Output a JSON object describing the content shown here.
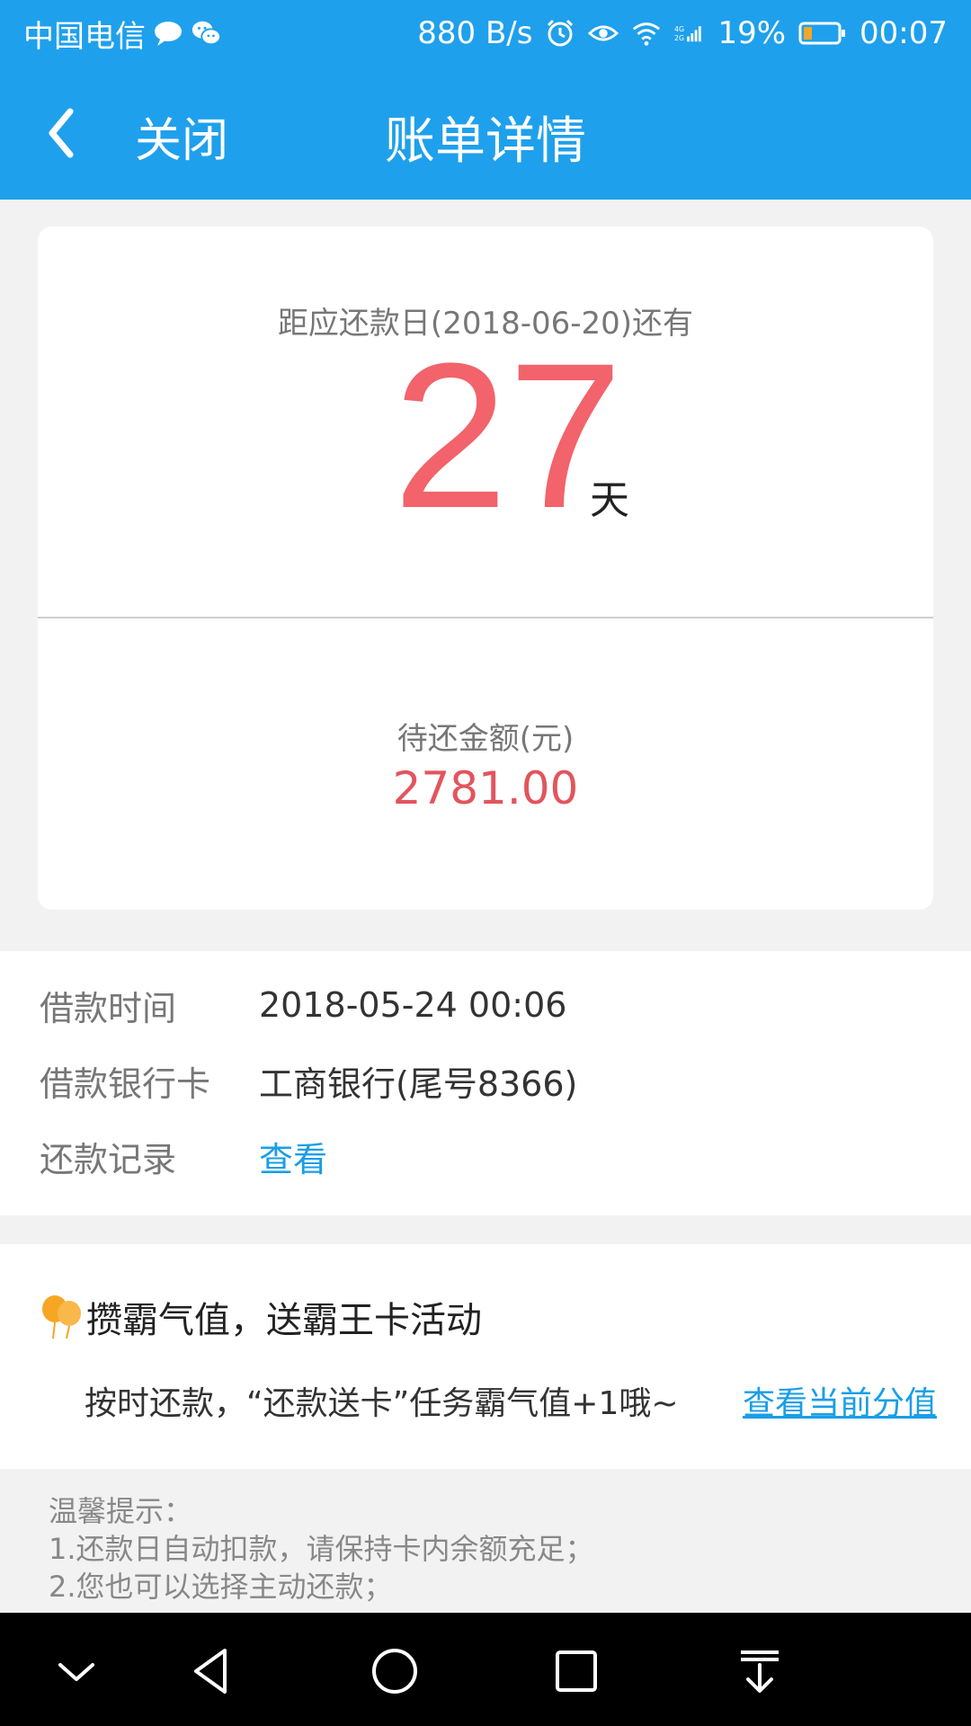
{
  "status_bar": {
    "carrier": "中国电信",
    "speed": "880 B/s",
    "battery": "19%",
    "time": "00:07",
    "icons": [
      "message-bubble-icon",
      "wechat-icon",
      "alarm-icon",
      "eye-icon",
      "wifi-icon",
      "signal-icon",
      "battery-icon"
    ]
  },
  "header": {
    "close_label": "关闭",
    "title": "账单详情"
  },
  "due": {
    "caption": "距应还款日(2018-06-20)还有",
    "days": "27",
    "unit": "天"
  },
  "amount": {
    "label": "待还金额(元)",
    "value": "2781.00"
  },
  "info": {
    "rows": [
      {
        "label": "借款时间",
        "value": "2018-05-24 00:06"
      },
      {
        "label": "借款银行卡",
        "value": "工商银行(尾号8366)"
      },
      {
        "label": "还款记录",
        "value": "查看"
      }
    ]
  },
  "promo": {
    "title": "攒霸气值，送霸王卡活动",
    "desc": "按时还款，“还款送卡”任务霸气值+1哦~",
    "link": "查看当前分值"
  },
  "tips": {
    "heading": "温馨提示：",
    "lines": [
      "1.还款日自动扣款，请保持卡内余额充足；",
      "2.您也可以选择主动还款；"
    ]
  },
  "colors": {
    "primary": "#1fa0ec",
    "accent_red": "#f2636b",
    "link": "#1a9ee6"
  }
}
